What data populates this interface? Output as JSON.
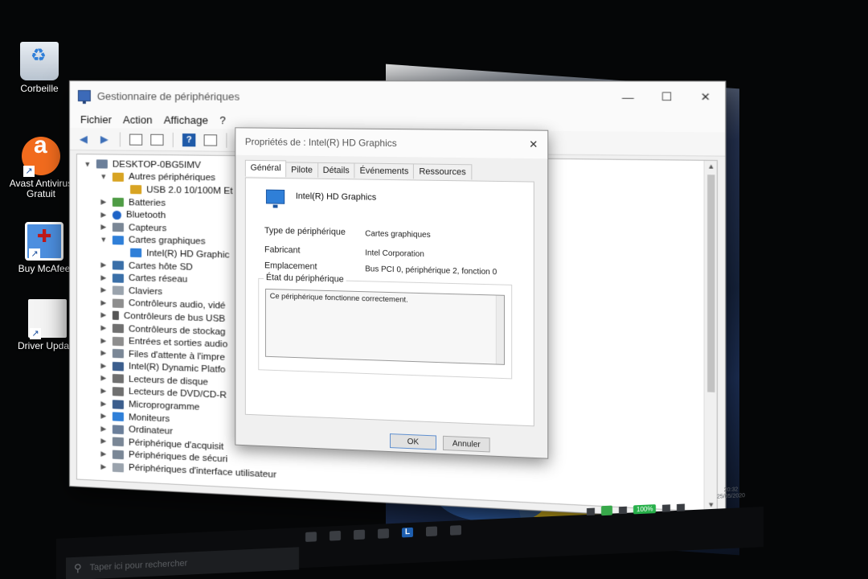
{
  "desktop": {
    "icons": [
      {
        "label": "Corbeille",
        "icon": "recycle-bin-icon"
      },
      {
        "label": "Avast Antivirus Gratuit",
        "icon": "avast-icon"
      },
      {
        "label": "Buy McAfee",
        "icon": "mcafee-icon"
      },
      {
        "label": "Driver Update",
        "icon": "document-icon"
      }
    ]
  },
  "device_manager": {
    "title": "Gestionnaire de périphériques",
    "window_buttons": {
      "minimize": "—",
      "maximize": "☐",
      "close": "✕"
    },
    "menu": [
      "Fichier",
      "Action",
      "Affichage",
      "?"
    ],
    "toolbar": {
      "back": "◀",
      "forward": "▶",
      "help": "?"
    },
    "tree": [
      {
        "label": "DESKTOP-0BG5IMV",
        "icon": "computer-icon",
        "expander": "▼"
      },
      {
        "label": "Autres périphériques",
        "icon": "warning-device-icon",
        "expander": "▼"
      },
      {
        "label": "USB 2.0 10/100M Et",
        "icon": "unknown-device-icon",
        "expander": ""
      },
      {
        "label": "Batteries",
        "icon": "battery-icon",
        "expander": "▶"
      },
      {
        "label": "Bluetooth",
        "icon": "bluetooth-icon",
        "expander": "▶"
      },
      {
        "label": "Capteurs",
        "icon": "sensor-icon",
        "expander": "▶"
      },
      {
        "label": "Cartes graphiques",
        "icon": "display-adapter-icon",
        "expander": "▼"
      },
      {
        "label": "Intel(R) HD Graphic",
        "icon": "display-adapter-icon",
        "expander": ""
      },
      {
        "label": "Cartes hôte SD",
        "icon": "sd-host-icon",
        "expander": "▶"
      },
      {
        "label": "Cartes réseau",
        "icon": "network-adapter-icon",
        "expander": "▶"
      },
      {
        "label": "Claviers",
        "icon": "keyboard-icon",
        "expander": "▶"
      },
      {
        "label": "Contrôleurs audio, vidé",
        "icon": "audio-icon",
        "expander": "▶"
      },
      {
        "label": "Contrôleurs de bus USB",
        "icon": "usb-icon",
        "expander": "▶"
      },
      {
        "label": "Contrôleurs de stockag",
        "icon": "storage-icon",
        "expander": "▶"
      },
      {
        "label": "Entrées et sorties audio",
        "icon": "audio-io-icon",
        "expander": "▶"
      },
      {
        "label": "Files d'attente à l'impre",
        "icon": "print-queue-icon",
        "expander": "▶"
      },
      {
        "label": "Intel(R) Dynamic Platfo",
        "icon": "chip-icon",
        "expander": "▶"
      },
      {
        "label": "Lecteurs de disque",
        "icon": "disk-icon",
        "expander": "▶"
      },
      {
        "label": "Lecteurs de DVD/CD-R",
        "icon": "dvd-icon",
        "expander": "▶"
      },
      {
        "label": "Microprogramme",
        "icon": "firmware-icon",
        "expander": "▶"
      },
      {
        "label": "Moniteurs",
        "icon": "monitor-icon",
        "expander": "▶"
      },
      {
        "label": "Ordinateur",
        "icon": "computer-icon",
        "expander": "▶"
      },
      {
        "label": "Périphérique d'acquisit",
        "icon": "imaging-icon",
        "expander": "▶"
      },
      {
        "label": "Périphériques de sécuri",
        "icon": "security-icon",
        "expander": "▶"
      },
      {
        "label": "Périphériques d'interface utilisateur",
        "icon": "hid-icon",
        "expander": "▶"
      }
    ]
  },
  "properties_dialog": {
    "title": "Propriétés de : Intel(R) HD Graphics",
    "close": "✕",
    "tabs": [
      "Général",
      "Pilote",
      "Détails",
      "Événements",
      "Ressources"
    ],
    "active_tab": "Général",
    "device_name": "Intel(R) HD Graphics",
    "fields": [
      {
        "label": "Type de périphérique",
        "value": "Cartes graphiques"
      },
      {
        "label": "Fabricant",
        "value": "Intel Corporation"
      },
      {
        "label": "Emplacement",
        "value": "Bus PCI 0, périphérique 2, fonction 0"
      }
    ],
    "status_group_title": "État du périphérique",
    "status_text": "Ce périphérique fonctionne correctement.",
    "ok_label": "OK",
    "cancel_label": "Annuler"
  },
  "taskbar": {
    "search_placeholder": "Taper ici pour rechercher",
    "battery_label": "100%",
    "time": "20:32",
    "date": "25/05/2020"
  },
  "colors": {
    "accent": "#2f7fd8",
    "battery_badge": "#27b04a",
    "avast_orange": "#f26b1d"
  }
}
